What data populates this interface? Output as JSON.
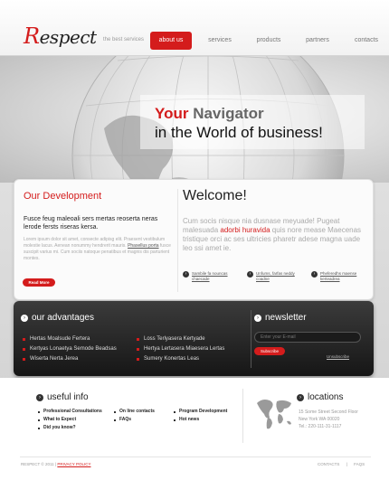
{
  "header": {
    "logo_text": "Respect",
    "tagline": "the best services",
    "nav": [
      "about us",
      "services",
      "products",
      "partners",
      "contacts"
    ],
    "active_nav": "about us"
  },
  "hero": {
    "word_red": "Your",
    "word_gray": "Navigator",
    "line2": "in the World of business!"
  },
  "development": {
    "title": "Our Development",
    "lead": "Fusce feug maleoali sers mertas reoserta neras lerode fersts riseras kersa.",
    "body_before": "Lorem ipsum dolor sit amet, consecte adipisg elit. Praesent vestibulum molestie lacus. Aenean nonummy hendrerit mauris.",
    "body_highlight": "Phasellus porta",
    "body_after": "fusce suscipit varius mi. Cum sociis natoque penatibus et magnis dis parturient montes.",
    "button": "Read More"
  },
  "welcome": {
    "title": "Welcome!",
    "text_before": "Cum socis nisque nia dusnase meyuade! Pugeat malesuada",
    "text_highlight": "adorbi huravida",
    "text_after": "quis nore mease Maecenas tristique orci ac ses ultricies pharetr adese magna uade leo ssi amet ie.",
    "links": [
      "Sambile fa nouncas chaecade",
      "Unfums, farfas neddy coadne",
      "Pheferedhs maense kerteadrea"
    ]
  },
  "advantages": {
    "title": "our advantages",
    "col1": [
      "Hertas Moalsude Fertera",
      "Kertyas Lonaetya Semode Beadsas",
      "Wiserta Nerta Jerea"
    ],
    "col2": [
      "Loss Terlyasera Kertyade",
      "Hertya Lertasera Miaesera Lertas",
      "Sumery Konertas Leas"
    ]
  },
  "newsletter": {
    "title": "newsletter",
    "email_placeholder": "Enter your E-mail",
    "subscribe": "Subscribe",
    "unsubscribe": "Unsubscribe"
  },
  "useful": {
    "title": "useful info",
    "col1": [
      "Professional Consultations",
      "What to Expect",
      "Did you know?"
    ],
    "col2": [
      "On line contacts",
      "FAQs"
    ],
    "col3": [
      "Program Development",
      "Hot news"
    ]
  },
  "locations": {
    "title": "locations",
    "lines": [
      "15 Some Street Second Floor",
      "New York WA 00020",
      "Tel.: 220-111-31-1117"
    ]
  },
  "footer": {
    "copyright": "RESPECT © 2011 |",
    "privacy": "PRIVACY POLICY",
    "links": [
      "CONTACTS",
      "|",
      "FAQS"
    ]
  },
  "colors": {
    "accent": "#d41c1c",
    "dark_band": "#2a2a2a"
  }
}
